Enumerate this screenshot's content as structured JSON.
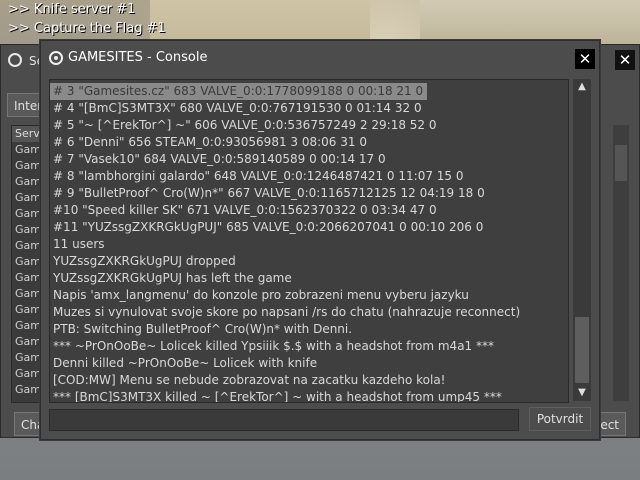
{
  "hud": {
    "lines": [
      ">>  Knife server #1",
      ">>  Capture the Flag #1"
    ]
  },
  "background_window": {
    "title": "Se",
    "tab_label": "Inter",
    "list_header": "Serve",
    "rows": [
      "Game",
      "Game",
      "Game",
      "Game",
      "Game",
      "Game",
      "Game",
      "Game",
      "Game",
      "Game",
      "Game",
      "Game",
      "Game",
      "Game",
      "Game",
      "Game"
    ],
    "left_button": "Cha",
    "right_button": "ect",
    "close_icon": "✕"
  },
  "console": {
    "title": "GAMESITES - Console",
    "close_icon": "✕",
    "log": [
      "# 3 \"Gamesites.cz\" 683 VALVE_0:0:1778099188   0 00:18   21    0",
      "# 4 \"[BmC]S3MT3X\" 680 VALVE_0:0:767191530   0 01:14   32    0",
      "# 5 \"~ [^ErekTor^] ~\" 606 VALVE_0:0:536757249   2 29:18   52    0",
      "# 6  \"Denni\" 656 STEAM_0:0:93056981   3 08:06   31    0",
      "# 7 \"Vasek10\" 684 VALVE_0:0:589140589   0 00:14   17    0",
      "# 8 \"lambhorgini galardo\" 648 VALVE_0:0:1246487421   0 11:07   15    0",
      "# 9 \"BulletProof^ Cro(W)n*\" 667 VALVE_0:0:1165712125  12 04:19   18    0",
      "#10 \"Speed killer SK\" 671 VALVE_0:0:1562370322   0 03:34   47    0",
      "#11 \"YUZssgZXKRGkUgPUJ\" 685 VALVE_0:0:2066207041   0 00:10   206    0",
      "11 users",
      "YUZssgZXKRGkUgPUJ dropped",
      "YUZssgZXKRGkUgPUJ has left the game",
      "Napis 'amx_langmenu' do konzole pro zobrazeni menu vyberu jazyku",
      "Muzes si vynulovat svoje skore po napsani /rs do chatu (nahrazuje reconnect)",
      "PTB: Switching BulletProof^ Cro(W)n* with Denni.",
      "*** ~PrOnOoBe~ Lolicek killed Ypsiiik $.$ with a headshot from m4a1 ***",
      "Denni killed ~PrOnOoBe~ Lolicek with knife",
      "[COD:MW] Menu se nebude zobrazovat na zacatku kazdeho kola!",
      "*** [BmC]S3MT3X killed ~ [^ErekTor^] ~ with a headshot from ump45 ***"
    ],
    "input_value": "",
    "submit_label": "Potvrdit",
    "scroll_up_icon": "▲",
    "scroll_down_icon": "▼"
  }
}
